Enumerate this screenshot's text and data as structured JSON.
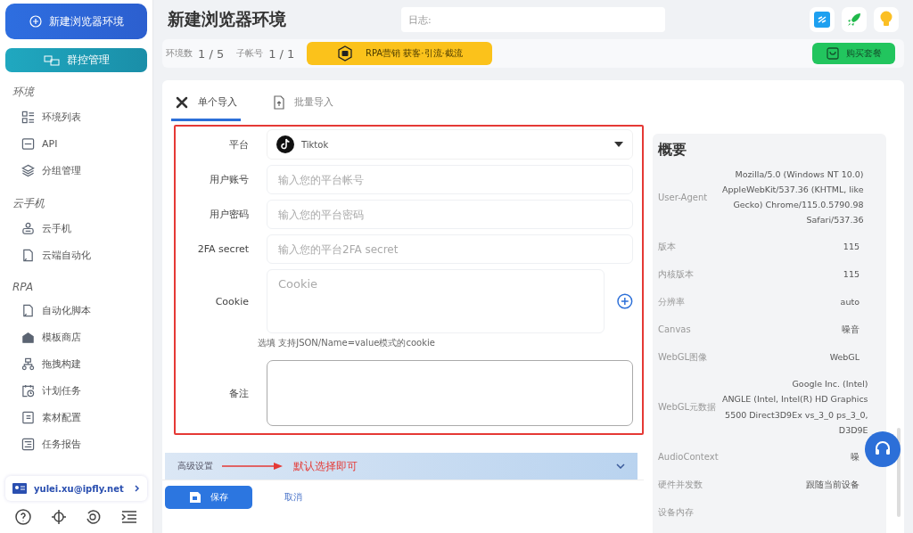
{
  "sidebar": {
    "primary_button": "新建浏览器环境",
    "group_button": "群控管理",
    "sections": [
      {
        "title": "环境",
        "items": [
          {
            "label": "环境列表",
            "kind": "list"
          },
          {
            "label": "API",
            "kind": "api"
          },
          {
            "label": "分组管理",
            "kind": "layers"
          }
        ]
      },
      {
        "title": "云手机",
        "items": [
          {
            "label": "云手机",
            "kind": "phone"
          },
          {
            "label": "云端自动化",
            "kind": "file"
          }
        ]
      },
      {
        "title": "RPA",
        "items": [
          {
            "label": "自动化脚本",
            "kind": "file"
          },
          {
            "label": "模板商店",
            "kind": "shop"
          },
          {
            "label": "拖拽构建",
            "kind": "tree"
          },
          {
            "label": "计划任务",
            "kind": "calendar"
          },
          {
            "label": "素材配置",
            "kind": "doc"
          },
          {
            "label": "任务报告",
            "kind": "report"
          }
        ]
      }
    ],
    "user": "yulei.xu@ipfly.net"
  },
  "header": {
    "title": "新建浏览器环境",
    "log_placeholder": "日志:"
  },
  "stats": [
    {
      "label": "环境数",
      "value": "1 / 5"
    },
    {
      "label": "子帐号",
      "value": "1 / 1"
    }
  ],
  "promo_button": "RPA营销 获客·引流·截流",
  "buy_button": "购买套餐",
  "tabs": [
    {
      "label": "单个导入",
      "selected": true
    },
    {
      "label": "批量导入",
      "selected": false
    }
  ],
  "form": {
    "platform": {
      "label": "平台",
      "value": "Tiktok"
    },
    "fields": [
      {
        "label": "用户账号",
        "placeholder": "输入您的平台帐号"
      },
      {
        "label": "用户密码",
        "placeholder": "输入您的平台密码"
      },
      {
        "label": "2FA secret",
        "placeholder": "输入您的平台2FA secret"
      }
    ],
    "cookie": {
      "label": "Cookie",
      "placeholder": "Cookie",
      "hint": "选填 支持JSON/Name=value模式的cookie"
    },
    "remark": {
      "label": "备注"
    }
  },
  "advanced": {
    "label": "高级设置",
    "annotation": "默认选择即可",
    "expanded": false
  },
  "actions": {
    "save": "保存",
    "cancel": "取消"
  },
  "summary": {
    "title": "概要",
    "rows": [
      {
        "label": "User-Agent",
        "value": [
          "Mozilla/5.0 (Windows NT 10.0)",
          "AppleWebKit/537.36 (KHTML, like",
          "Gecko) Chrome/115.0.5790.98",
          "Safari/537.36"
        ]
      },
      {
        "label": "版本",
        "value": [
          "115"
        ]
      },
      {
        "label": "内核版本",
        "value": [
          "115"
        ]
      },
      {
        "label": "分辨率",
        "value": [
          "auto"
        ]
      },
      {
        "label": "Canvas",
        "value": [
          "噪音"
        ]
      },
      {
        "label": "WebGL图像",
        "value": [
          "WebGL"
        ]
      },
      {
        "label": "WebGL元数据",
        "value": [
          "Google Inc. (Intel)",
          "ANGLE (Intel, Intel(R) HD Graphics",
          "5500 Direct3D9Ex vs_3_0 ps_3_0,",
          "D3D9E"
        ]
      },
      {
        "label": "AudioContext",
        "value": [
          "噪"
        ]
      },
      {
        "label": "硬件并发数",
        "value": [
          "跟随当前设备"
        ]
      },
      {
        "label": "设备内存",
        "value": []
      }
    ]
  }
}
